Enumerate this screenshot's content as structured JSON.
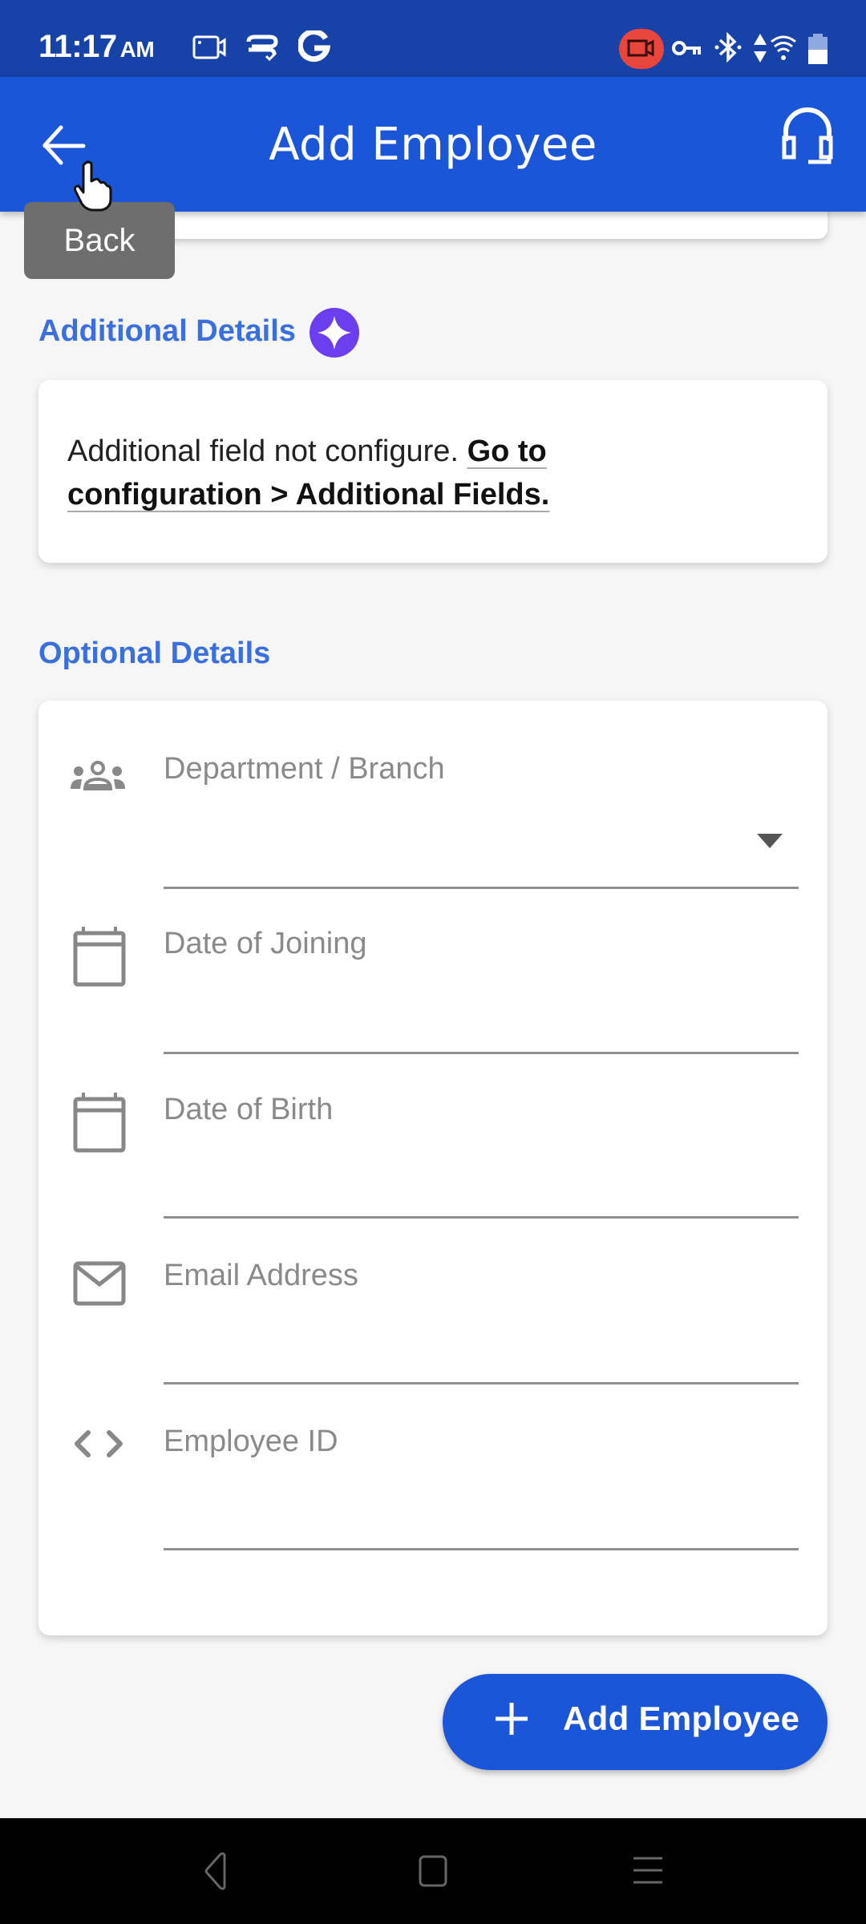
{
  "status_bar": {
    "time": "11:17",
    "ampm": "AM",
    "left_icons": [
      "screen-record-icon",
      "wallet-check-icon",
      "google-icon"
    ],
    "right_icons": [
      "recording-indicator-icon",
      "vpn-key-icon",
      "bluetooth-icon",
      "data-arrows-icon",
      "wifi-icon",
      "battery-icon"
    ],
    "recording_color": "#e8453c"
  },
  "app_bar": {
    "title": "Add Employee",
    "back_icon": "arrow-left-icon",
    "support_icon": "headset-icon",
    "color": "#1c56d8"
  },
  "tooltip": {
    "label": "Back"
  },
  "additional_details": {
    "title": "Additional Details",
    "badge_icon": "sparkle-icon",
    "badge_color": "#6b3ff0",
    "message": "Additional field not configure.",
    "link_text": "Go to configuration > Additional Fields."
  },
  "optional_details": {
    "title": "Optional Details",
    "fields": [
      {
        "label": "Department / Branch",
        "icon": "group-icon",
        "type": "dropdown",
        "value": ""
      },
      {
        "label": "Date of Joining",
        "icon": "calendar-icon",
        "type": "date",
        "value": ""
      },
      {
        "label": "Date of Birth",
        "icon": "calendar-icon",
        "type": "date",
        "value": ""
      },
      {
        "label": "Email Address",
        "icon": "mail-icon",
        "type": "email",
        "value": ""
      },
      {
        "label": "Employee ID",
        "icon": "code-icon",
        "type": "text",
        "value": ""
      }
    ]
  },
  "fab": {
    "label": "Add Employee",
    "icon": "plus-icon"
  },
  "nav_bar": {
    "buttons": [
      "back-triangle-icon",
      "home-square-icon",
      "recents-lines-icon"
    ]
  },
  "colors": {
    "accent": "#1c56d8",
    "status_bar": "#1742a8",
    "section_title": "#3a6fe0",
    "field_gray": "#8a8a8a"
  }
}
